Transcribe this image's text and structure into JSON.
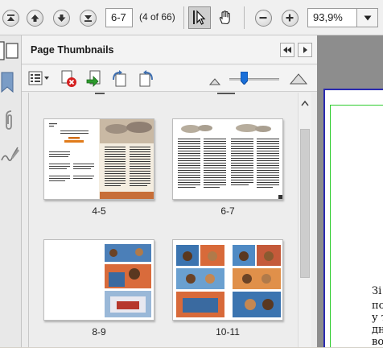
{
  "toolbar": {
    "page_value": "6-7",
    "page_count": "(4 of 66)",
    "zoom_value": "93,9%"
  },
  "panel": {
    "title": "Page Thumbnails"
  },
  "thumbnails": [
    {
      "label": "4-5"
    },
    {
      "label": "6-7"
    },
    {
      "label": "8-9"
    },
    {
      "label": "10-11"
    }
  ],
  "thumbnail_zoom": {
    "level_fraction": 0.3
  },
  "document": {
    "lines": [
      "Зі",
      "по",
      "у т",
      "дн",
      "во"
    ]
  },
  "icons": [
    "first-page-icon",
    "previous-page-icon",
    "next-page-icon",
    "last-page-icon",
    "select-tool-icon",
    "hand-tool-icon",
    "zoom-out-icon",
    "zoom-in-icon",
    "zoom-dropdown-icon",
    "pages-icon",
    "bookmark-icon",
    "attachment-icon",
    "signature-icon",
    "options-menu-icon",
    "delete-pages-icon",
    "insert-pages-icon",
    "rotate-ccw-icon",
    "rotate-cw-icon",
    "zoom-small-icon",
    "zoom-large-icon",
    "collapse-panel-icon",
    "expand-panel-icon"
  ]
}
